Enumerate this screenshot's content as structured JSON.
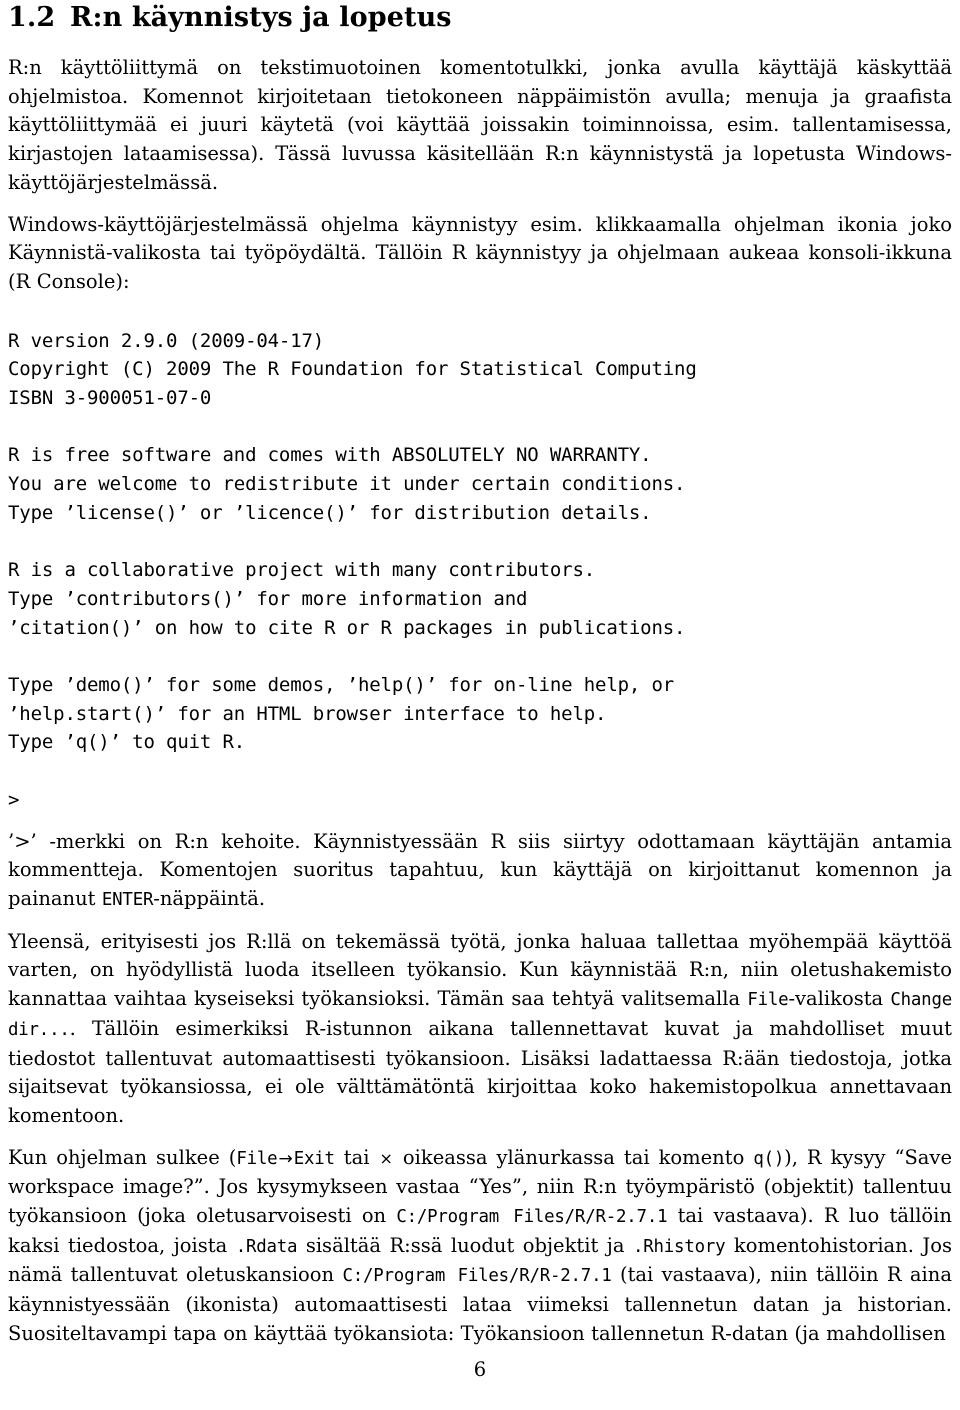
{
  "document": {
    "page_number": "6"
  },
  "heading": {
    "number": "1.2",
    "title": "R:n käynnistys ja lopetus"
  },
  "paragraphs": {
    "intro": {
      "part1": "R:n käyttöliittymä on tekstimuotoinen komentotulkki, jonka avulla käyttäjä käskyttää ohjelmistoa. Komennot kirjoitetaan tietokoneen näppäimistön avulla; menuja ja graafista käyttöliittymää ei juuri käytetä (voi käyttää joissakin toiminnoissa, esim. tallentamisessa, kirjastojen lataamisessa). Tässä luvussa käsitellään R:n käynnistystä ja lopetusta Windows-käyttöjärjestelmässä."
    },
    "startup": {
      "part1": "Windows-käyttöjärjestelmässä ohjelma käynnistyy esim. klikkaamalla ohjelman ikonia joko Käynnistä-valikosta tai työpöydältä. Tällöin R käynnistyy ja ohjelmaan aukeaa konsoli-ikkuna (R Console):"
    },
    "prompt": {
      "lead": "’>’ -merkki on R:n kehoite. Käynnistyessään R siis siirtyy odottamaan käyttäjän antamia kommentteja. Komentojen suoritus tapahtuu, kun käyttäjä on kirjoittanut komennon ja painanut ",
      "enter_code": "ENTER",
      "tail": "-näppäintä."
    },
    "workdir": {
      "part1": "Yleensä, erityisesti jos R:llä on tekemässä työtä, jonka haluaa tallettaa myöhempää käyttöä varten, on hyödyllistä luoda itselleen työkansio. Kun käynnistää R:n, niin oletushakemisto kannattaa vaihtaa kyseiseksi työkansioksi. Tämän saa tehtyä valitsemalla ",
      "file_code": "File",
      "part2": "-valikosta ",
      "change_code": "Change dir...",
      "part3": ". Tällöin esimerkiksi R-istunnon aikana tallennettavat kuvat ja mahdolliset muut tiedostot tallentuvat automaattisesti työkansioon. Lisäksi ladattaessa R:ään tiedostoja, jotka sijaitsevat työkansiossa, ei ole välttämätöntä kirjoittaa koko hakemistopolkua annettavaan komentoon."
    },
    "closing": {
      "p1": "Kun ohjelman sulkee (",
      "file_code": "File",
      "arrow": "→",
      "exit_code": "Exit",
      "p2": " tai ",
      "times": "×",
      "p3": " oikeassa ylänurkassa tai komento ",
      "q_code": "q()",
      "p4": "), R kysyy “Save workspace image?”. Jos kysymykseen vastaa “Yes”, niin R:n työympäristö (objektit) tallentuu työkansioon (joka oletusarvoisesti on ",
      "path1_code": "C:/Program Files/R/R-2.7.1",
      "p5": " tai vastaava). R luo tällöin kaksi tiedostoa, joista ",
      "rdata_code": ".Rdata",
      "p6": " sisältää R:ssä luodut objektit ja ",
      "rhistory_code": ".Rhistory",
      "p7": " komentohistorian. Jos nämä tallentuvat oletuskansioon ",
      "path2_code": "C:/Program Files/R/R-2.7.1",
      "p8": " (tai vastaava), niin tällöin R aina käynnistyessään (ikonista) automaattisesti lataa viimeksi tallennetun datan ja historian. Suositeltavampi tapa on käyttää työkansiota: Työkansioon tallennetun R-datan (ja mahdollisen"
    }
  },
  "console": {
    "text": "R version 2.9.0 (2009-04-17)\nCopyright (C) 2009 The R Foundation for Statistical Computing\nISBN 3-900051-07-0\n\nR is free software and comes with ABSOLUTELY NO WARRANTY.\nYou are welcome to redistribute it under certain conditions.\nType ’license()’ or ’licence()’ for distribution details.\n\nR is a collaborative project with many contributors.\nType ’contributors()’ for more information and\n’citation()’ on how to cite R or R packages in publications.\n\nType ’demo()’ for some demos, ’help()’ for on-line help, or\n’help.start()’ for an HTML browser interface to help.\nType ’q()’ to quit R.\n\n>"
  }
}
